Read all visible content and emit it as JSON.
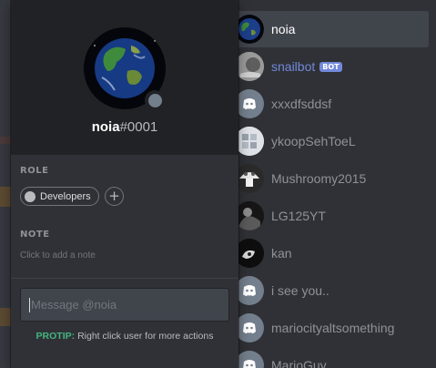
{
  "colors": {
    "popout_bg": "#2f3136",
    "header_bg": "#202225",
    "accent_green": "#43b581",
    "bot_blurple": "#7289da",
    "offline_grey": "#747f8d"
  },
  "profile": {
    "username": "noia",
    "discriminator": "#0001",
    "status": "offline",
    "avatar_icon": "earth-globe-icon",
    "roles_label": "ROLE",
    "roles": [
      {
        "name": "Developers",
        "color": "#b9bbbe"
      }
    ],
    "add_role_symbol": "+",
    "note_label": "NOTE",
    "note_placeholder": "Click to add a note",
    "message_placeholder": "Message @noia",
    "protip_label": "PROTIP:",
    "protip_text": "Right click user for more actions"
  },
  "members": [
    {
      "name": "noia",
      "avatar": "earth-globe-icon",
      "selected": true
    },
    {
      "name": "snailbot",
      "avatar": "snail-avatar",
      "bot": true,
      "bot_tag": "BOT"
    },
    {
      "name": "xxxdfsddsf",
      "avatar": "discord-default-icon"
    },
    {
      "name": "ykoopSehToeL",
      "avatar": "windows-logo-avatar"
    },
    {
      "name": "Mushroomy2015",
      "avatar": "mushroom-avatar"
    },
    {
      "name": "LG125YT",
      "avatar": "dark-photo-avatar"
    },
    {
      "name": "kan",
      "avatar": "dark-drawing-avatar"
    },
    {
      "name": "i see you..",
      "avatar": "discord-default-icon"
    },
    {
      "name": "mariocityaltsomething",
      "avatar": "discord-default-icon"
    },
    {
      "name": "MarioGuy",
      "avatar": "discord-default-icon"
    }
  ]
}
